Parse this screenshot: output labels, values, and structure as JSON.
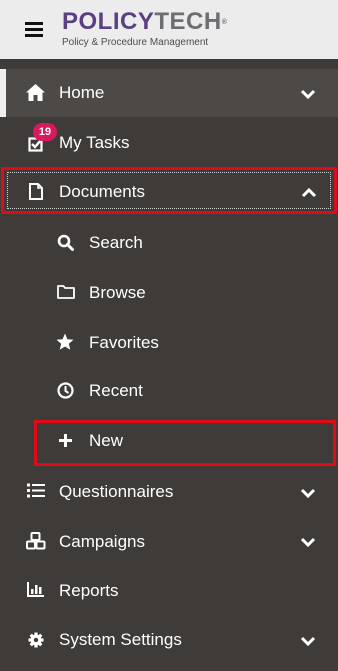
{
  "header": {
    "menu_icon": "hamburger-icon",
    "logo": {
      "policy": "POLICY",
      "tech": "TECH",
      "reg": "®",
      "subtitle": "Policy & Procedure Management"
    }
  },
  "nav": {
    "home": {
      "label": "Home",
      "icon": "home-icon",
      "expanded": false
    },
    "my_tasks": {
      "label": "My Tasks",
      "icon": "checkbox-icon",
      "badge": "19"
    },
    "documents": {
      "label": "Documents",
      "icon": "document-icon",
      "expanded": true,
      "children": {
        "search": {
          "label": "Search",
          "icon": "search-icon"
        },
        "browse": {
          "label": "Browse",
          "icon": "folder-icon"
        },
        "favorites": {
          "label": "Favorites",
          "icon": "star-icon"
        },
        "recent": {
          "label": "Recent",
          "icon": "clock-icon"
        },
        "new": {
          "label": "New",
          "icon": "plus-icon"
        }
      }
    },
    "questionnaires": {
      "label": "Questionnaires",
      "icon": "list-icon",
      "expanded": false
    },
    "campaigns": {
      "label": "Campaigns",
      "icon": "cubes-icon",
      "expanded": false
    },
    "reports": {
      "label": "Reports",
      "icon": "bar-chart-icon"
    },
    "system_settings": {
      "label": "System Settings",
      "icon": "gear-icon",
      "expanded": false
    }
  },
  "colors": {
    "background": "#3e3b39",
    "active_background": "#4c4947",
    "header_background": "#ececec",
    "brand_purple": "#5b3f82",
    "badge": "#d9195e",
    "highlight": "#e10b17"
  }
}
